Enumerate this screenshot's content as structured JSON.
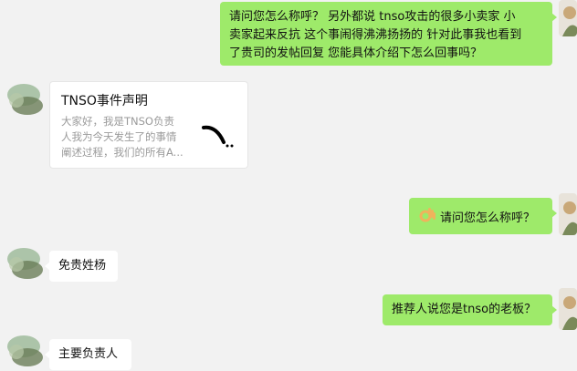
{
  "messages": {
    "m1": {
      "lines": [
        "请问您怎么称呼？  另外都说 tnso攻击的很多小卖家  小",
        "卖家起来反抗  这个事闹得沸沸扬扬的 针对此事我也看到",
        "了贵司的发帖回复  您能具体介绍下怎么回事吗？"
      ]
    },
    "card": {
      "title": "TNSO事件声明",
      "desc": [
        "大家好，我是TNSO负责",
        "人我为今天发生了的事情",
        "阐述过程，我们的所有A..."
      ]
    },
    "m2": {
      "text": "请问您怎么称呼？",
      "icon": "ok-hand-emoji"
    },
    "m3": {
      "text": "免贵姓杨"
    },
    "m4": {
      "text": "推荐人说您是tnso的老板？"
    },
    "m5": {
      "text": "主要负责人"
    }
  },
  "colors": {
    "outgoing": "#9eea6a",
    "incoming": "#ffffff",
    "background": "#f2f2f2"
  }
}
